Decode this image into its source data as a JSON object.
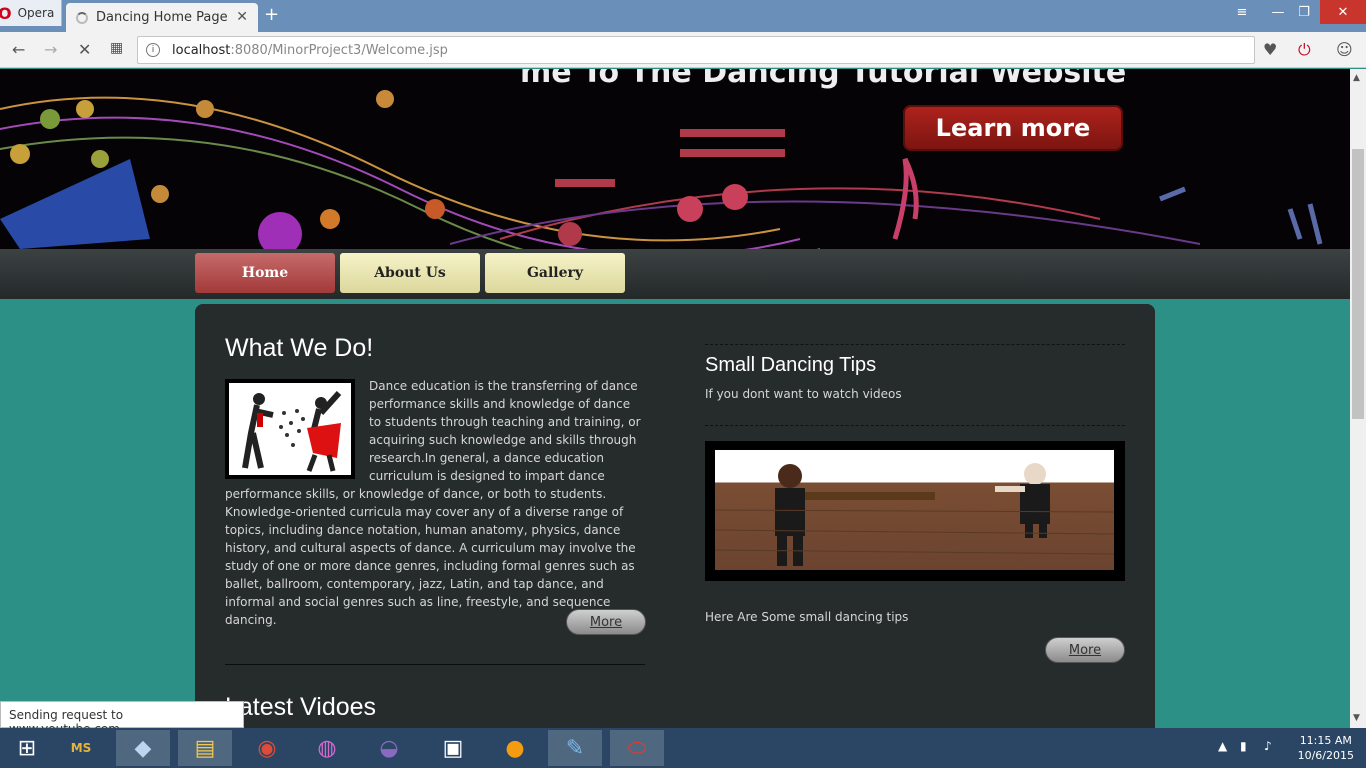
{
  "browser": {
    "menu_label": "Opera",
    "tab_title": "Dancing Home Page",
    "url_host": "localhost",
    "url_rest": ":8080/MinorProject3/Welcome.jsp",
    "status_text": "Sending request to www.youtube.com..."
  },
  "banner": {
    "headline": "me To The Dancing Tutorial Website",
    "learn_more": "Learn more"
  },
  "nav": {
    "home": "Home",
    "about": "About Us",
    "gallery": "Gallery"
  },
  "main": {
    "what_title": "What We Do!",
    "what_text": "Dance education is the transferring of dance performance skills and knowledge of dance to students through teaching and training, or acquiring such knowledge and skills through research.In general, a dance education curriculum is designed to impart dance performance skills, or knowledge of dance, or both to students. Knowledge-oriented curricula may cover any of a diverse range of topics, including dance notation, human anatomy, physics, dance history, and cultural aspects of dance. A curriculum may involve the study of one or more dance genres, including formal genres such as ballet, ballroom, contemporary, jazz, Latin, and tap dance, and informal and social genres such as line, freestyle, and sequence dancing.",
    "more_left": "More",
    "tips_title": "Small Dancing Tips",
    "tips_sub": "If you dont want to watch videos",
    "tips_caption": "Here Are Some small dancing tips",
    "more_right": "More",
    "latest_title": "Latest Vidoes"
  },
  "taskbar": {
    "time": "11:15 AM",
    "date": "10/6/2015"
  }
}
